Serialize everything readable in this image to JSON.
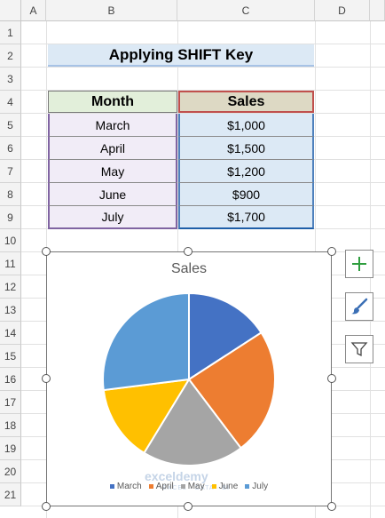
{
  "columns": [
    "A",
    "B",
    "C",
    "D"
  ],
  "rows": [
    "1",
    "2",
    "3",
    "4",
    "5",
    "6",
    "7",
    "8",
    "9",
    "10",
    "11",
    "12",
    "13",
    "14",
    "15",
    "16",
    "17",
    "18",
    "19",
    "20",
    "21"
  ],
  "sheet_title": "Applying SHIFT Key",
  "table": {
    "headers": [
      "Month",
      "Sales"
    ],
    "rows": [
      [
        "March",
        "$1,000"
      ],
      [
        "April",
        "$1,500"
      ],
      [
        "May",
        "$1,200"
      ],
      [
        "June",
        "$900"
      ],
      [
        "July",
        "$1,700"
      ]
    ]
  },
  "chart_data": {
    "type": "pie",
    "title": "Sales",
    "categories": [
      "March",
      "April",
      "May",
      "June",
      "July"
    ],
    "values": [
      1000,
      1500,
      1200,
      900,
      1700
    ],
    "colors": [
      "#4472c4",
      "#ed7d31",
      "#a5a5a5",
      "#ffc000",
      "#5b9bd5"
    ],
    "legend_position": "bottom"
  },
  "watermark": {
    "name": "exceldemy",
    "tagline": "EXCEL · DATA · BI"
  },
  "side_buttons": [
    {
      "icon": "plus-icon",
      "name": "chart-elements-button"
    },
    {
      "icon": "brush-icon",
      "name": "chart-styles-button"
    },
    {
      "icon": "filter-icon",
      "name": "chart-filters-button"
    }
  ]
}
